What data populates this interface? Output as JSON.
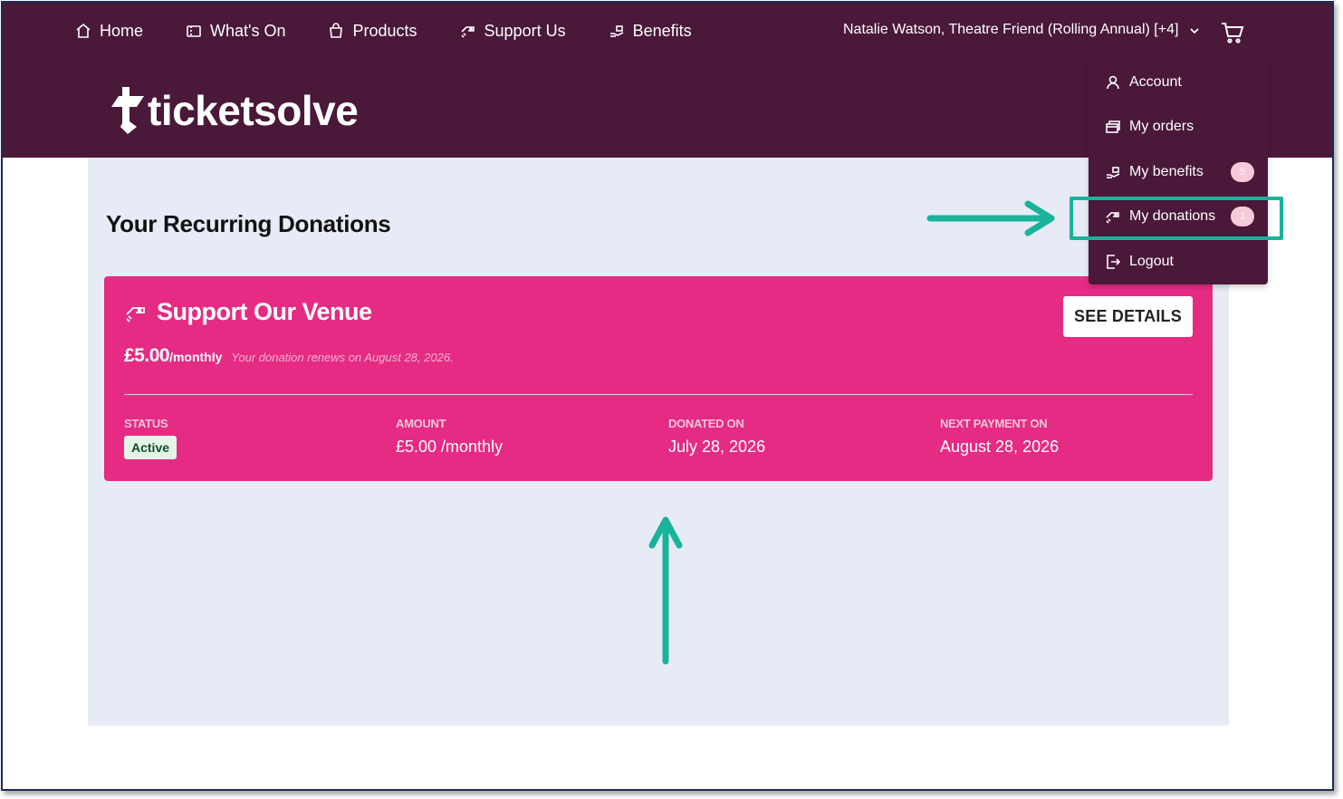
{
  "nav": {
    "items": [
      {
        "label": "Home",
        "icon": "home-icon"
      },
      {
        "label": "What's On",
        "icon": "ticket-icon"
      },
      {
        "label": "Products",
        "icon": "shopping-bag-icon"
      },
      {
        "label": "Support Us",
        "icon": "donate-hand-icon"
      },
      {
        "label": "Benefits",
        "icon": "gift-hand-icon"
      }
    ],
    "user_label": "Natalie Watson, Theatre Friend (Rolling Annual) [+4]",
    "cart_icon": "cart-icon"
  },
  "brand": {
    "logo_text": "ticketsolve"
  },
  "page": {
    "title": "Your Recurring Donations"
  },
  "donation": {
    "title": "Support Our Venue",
    "price": "£5.00",
    "period": "/monthly",
    "renew_text": "Your donation renews on August 28, 2026.",
    "details_button": "SEE DETAILS",
    "status_label": "STATUS",
    "status_value": "Active",
    "amount_label": "AMOUNT",
    "amount_value": "£5.00 /monthly",
    "donated_label": "DONATED ON",
    "donated_value": "July 28, 2026",
    "next_label": "NEXT PAYMENT ON",
    "next_value": "August 28, 2026"
  },
  "dropdown": {
    "account": "Account",
    "orders": "My orders",
    "benefits": "My benefits",
    "benefits_count": "5",
    "donations": "My donations",
    "donations_count": "1",
    "logout": "Logout"
  },
  "colors": {
    "header_bg": "#4a1839",
    "card_bg": "#e62b84",
    "content_bg": "#e7ebf5",
    "annotation": "#19b39b"
  }
}
